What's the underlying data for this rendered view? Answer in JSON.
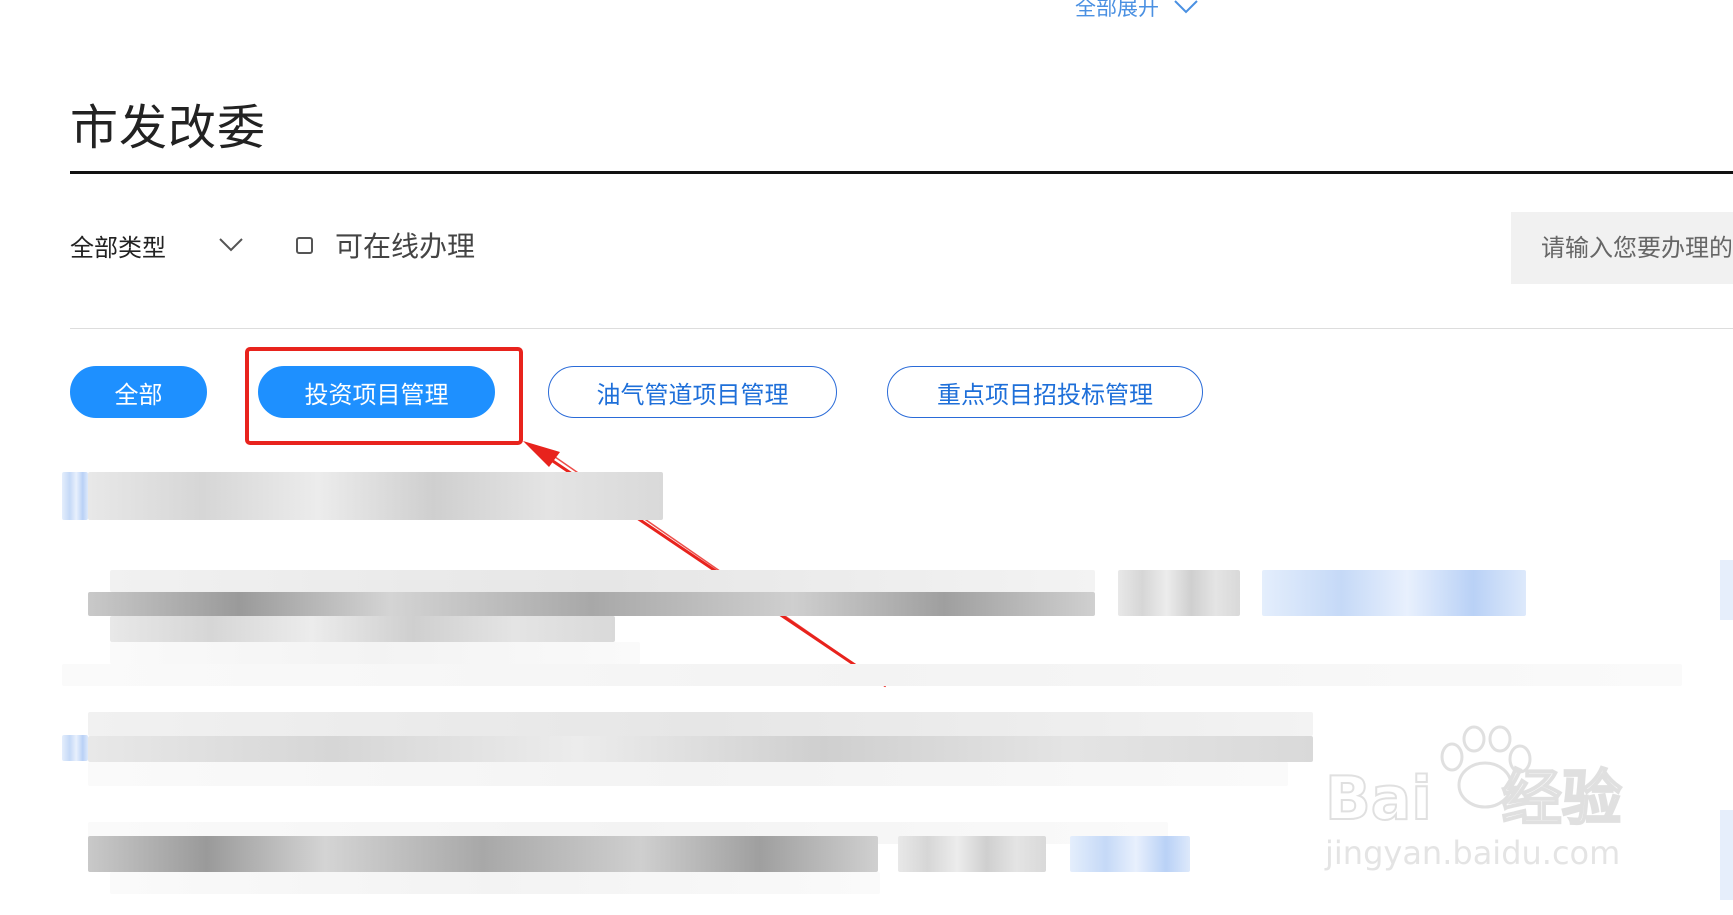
{
  "header": {
    "expand_all": "全部展开"
  },
  "department": {
    "title": "市发改委"
  },
  "filters": {
    "type_select": "全部类型",
    "online_checkbox_label": "可在线办理",
    "online_checked": false,
    "search_placeholder": "请输入您要办理的"
  },
  "tabs": [
    {
      "label": "全部",
      "active": true
    },
    {
      "label": "投资项目管理",
      "active": true
    },
    {
      "label": "油气管道项目管理",
      "active": false
    },
    {
      "label": "重点项目招投标管理",
      "active": false
    }
  ],
  "watermark": {
    "brand": "Bai du 经验",
    "url": "jingyan.baidu.com"
  },
  "colors": {
    "accent": "#1e90ff",
    "outline": "#2a6bd8",
    "annotation": "#e8231d"
  }
}
